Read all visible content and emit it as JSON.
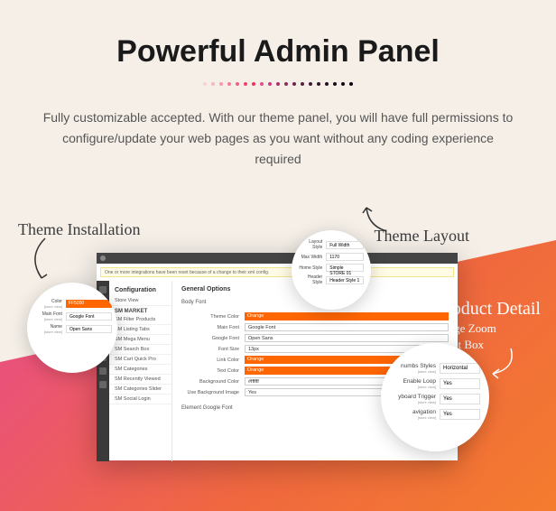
{
  "hero": {
    "title": "Powerful Admin Panel",
    "description": "Fully customizable accepted. With our theme panel, you will have full permissions to configure/update your web pages as you want without any coding experience required"
  },
  "labels": {
    "theme_installation": "Theme Installation",
    "theme_layout": "Theme Layout",
    "product_detail": "Product Detail",
    "image_zoom": "Image Zoom",
    "light_box": "Light Box"
  },
  "panel": {
    "warning": "One or more integrations have been reset because of a change to their xml config.",
    "config_title": "Configuration",
    "store_view": "Store View",
    "nav_group": "SM MARKET",
    "nav_items": [
      "SM Filter Products",
      "SM Listing Tabs",
      "SM Mega Menu",
      "SM Search Box",
      "SM Cart Quick Pro",
      "SM Categories",
      "SM Recently Viewed",
      "SM Categories Slider",
      "SM Social Login"
    ],
    "main_title": "General Options",
    "body_font": "Body Font",
    "rows": [
      {
        "label": "Theme Color",
        "value": "Orange",
        "orange": true
      },
      {
        "label": "Main Font",
        "value": "Google Font"
      },
      {
        "label": "Google Font",
        "value": "Open Sans"
      },
      {
        "label": "Font Size",
        "value": "13px"
      },
      {
        "label": "Link Color",
        "value": "Orange",
        "orange": true
      },
      {
        "label": "Text Color",
        "value": "Orange",
        "orange": true
      },
      {
        "label": "Background Color",
        "value": "#ffffff"
      },
      {
        "label": "Use Background Image",
        "value": "Yes"
      }
    ],
    "google_font_section": "Element Google Font"
  },
  "callout_layout": {
    "rows": [
      {
        "label": "Layout Style",
        "value": "Full Width"
      },
      {
        "label": "Max Width",
        "value": "1170"
      },
      {
        "label": "Home Style",
        "value": "Simple STORE 01"
      },
      {
        "label": "Header Style",
        "value": "Header Style 1"
      }
    ]
  },
  "callout_install": {
    "rows": [
      {
        "label": "Color",
        "value": "FF5000",
        "orange": true
      },
      {
        "label": "Main Font",
        "value": "Google Font"
      },
      {
        "label": "Name",
        "value": "Open Sans"
      }
    ],
    "scope": "[store view]"
  },
  "callout_product": {
    "rows": [
      {
        "label": "numbs Styles",
        "sub": "[store view]",
        "value": "Horizontal"
      },
      {
        "label": "Enable Loop",
        "sub": "[store view]",
        "value": "Yes"
      },
      {
        "label": "yboard Trigger",
        "sub": "[store view]",
        "value": "Yes"
      },
      {
        "label": "avigation",
        "sub": "[store view]",
        "value": "Yes"
      }
    ]
  },
  "dot_colors": [
    "#f4d4d8",
    "#f4b8c2",
    "#f49aac",
    "#f47c96",
    "#f45e80",
    "#f4406a",
    "#ef2f5c",
    "#e84a8f",
    "#c93d7c",
    "#a9346b",
    "#8b2c5a",
    "#6e254a",
    "#572040",
    "#421a35",
    "#30152b",
    "#221023",
    "#170c1c",
    "#100816",
    "#0a0511"
  ]
}
